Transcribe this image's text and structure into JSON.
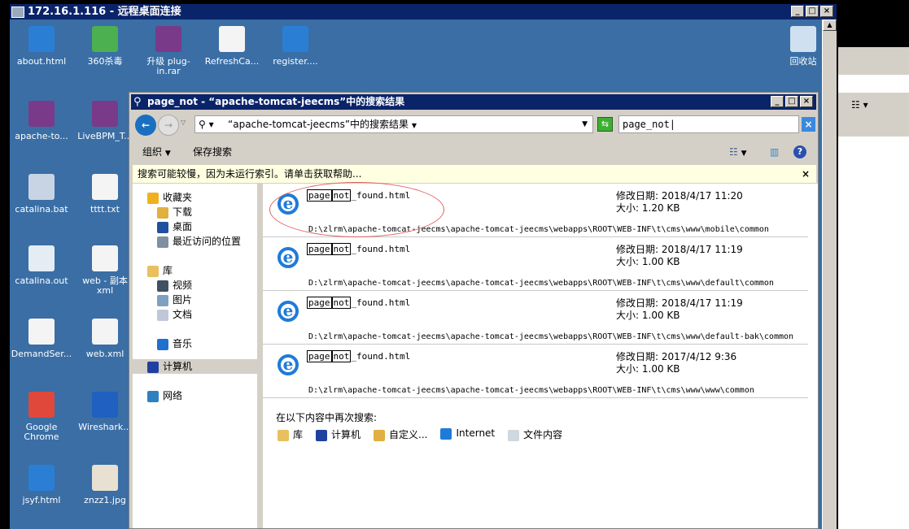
{
  "rdp": {
    "title": "172.16.1.116 - 远程桌面连接"
  },
  "desktop_icons": [
    {
      "label": "about.html",
      "color": "#2a7fd4"
    },
    {
      "label": "360杀毒",
      "color": "#4caf50"
    },
    {
      "label": "升级 plug-in.rar",
      "color": "#7a3a8a"
    },
    {
      "label": "RefreshCa...",
      "color": "#f4f4f4"
    },
    {
      "label": "register....",
      "color": "#2a7fd4"
    },
    {
      "label": "apache-to...",
      "color": "#7a3a8a"
    },
    {
      "label": "LiveBPM_T...",
      "color": "#7a3a8a"
    },
    {
      "label": "catalina.bat",
      "color": "#c8d4e4"
    },
    {
      "label": "tttt.txt",
      "color": "#f4f4f4"
    },
    {
      "label": "catalina.out",
      "color": "#e4ecf4"
    },
    {
      "label": "web - 副本 xml",
      "color": "#f4f4f4"
    },
    {
      "label": "DemandSer...",
      "color": "#f4f4f4"
    },
    {
      "label": "web.xml",
      "color": "#f4f4f4"
    },
    {
      "label": "Google Chrome",
      "color": "#e0483b"
    },
    {
      "label": "Wireshark...",
      "color": "#2060c0"
    },
    {
      "label": "jsyf.html",
      "color": "#2a7fd4"
    },
    {
      "label": "znzz1.jpg",
      "color": "#e8e0d0"
    },
    {
      "label": "回收站",
      "color": "#cfe0f0"
    }
  ],
  "explorer": {
    "title": "page_not - “apache-tomcat-jeecms”中的搜索结果",
    "address": "“apache-tomcat-jeecms”中的搜索结果",
    "search_value": "page_not",
    "toolbar": {
      "organize": "组织",
      "save_search": "保存搜索"
    },
    "info_bar": "搜索可能较慢，因为未运行索引。请单击获取帮助...",
    "nav": [
      {
        "label": "收藏夹",
        "color": "#f0b020",
        "indent": 0
      },
      {
        "label": "下载",
        "color": "#e0b040",
        "indent": 1
      },
      {
        "label": "桌面",
        "color": "#2050a0",
        "indent": 1
      },
      {
        "label": "最近访问的位置",
        "color": "#8090a0",
        "indent": 1
      },
      {
        "label": "库",
        "color": "#e8c060",
        "indent": 0
      },
      {
        "label": "视频",
        "color": "#405060",
        "indent": 1
      },
      {
        "label": "图片",
        "color": "#80a0c0",
        "indent": 1
      },
      {
        "label": "文档",
        "color": "#c0c8d8",
        "indent": 1
      },
      {
        "label": "音乐",
        "color": "#2070d0",
        "indent": 1
      },
      {
        "label": "计算机",
        "color": "#2040a0",
        "indent": 0,
        "selected": true
      },
      {
        "label": "网络",
        "color": "#3080c0",
        "indent": 0
      }
    ],
    "results": [
      {
        "name_parts": [
          "page",
          "not",
          "found.html"
        ],
        "modified_label": "修改日期:",
        "modified": "2018/4/17 11:20",
        "size_label": "大小:",
        "size": "1.20 KB",
        "path": "D:\\zlrm\\apache-tomcat-jeecms\\apache-tomcat-jeecms\\webapps\\ROOT\\WEB-INF\\t\\cms\\www\\mobile\\common"
      },
      {
        "name_parts": [
          "page",
          "not",
          "found.html"
        ],
        "modified_label": "修改日期:",
        "modified": "2018/4/17 11:19",
        "size_label": "大小:",
        "size": "1.00 KB",
        "path": "D:\\zlrm\\apache-tomcat-jeecms\\apache-tomcat-jeecms\\webapps\\ROOT\\WEB-INF\\t\\cms\\www\\default\\common"
      },
      {
        "name_parts": [
          "page",
          "not",
          "found.html"
        ],
        "modified_label": "修改日期:",
        "modified": "2018/4/17 11:19",
        "size_label": "大小:",
        "size": "1.00 KB",
        "path": "D:\\zlrm\\apache-tomcat-jeecms\\apache-tomcat-jeecms\\webapps\\ROOT\\WEB-INF\\t\\cms\\www\\default-bak\\common"
      },
      {
        "name_parts": [
          "page",
          "not",
          "found.html"
        ],
        "modified_label": "修改日期:",
        "modified": "2017/4/12 9:36",
        "size_label": "大小:",
        "size": "1.00 KB",
        "path": "D:\\zlrm\\apache-tomcat-jeecms\\apache-tomcat-jeecms\\webapps\\ROOT\\WEB-INF\\t\\cms\\www\\www\\common"
      }
    ],
    "search_again": {
      "label": "在以下内容中再次搜索:",
      "options": [
        "库",
        "计算机",
        "自定义...",
        "Internet",
        "文件内容"
      ]
    }
  }
}
